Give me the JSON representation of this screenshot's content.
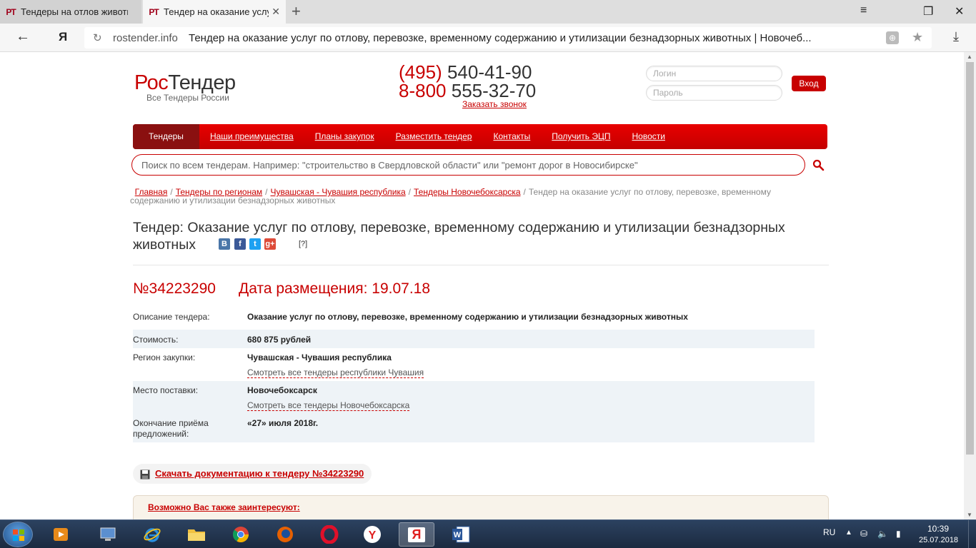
{
  "browser": {
    "tabs": [
      {
        "favicon": "PT",
        "title": "Тендеры на отлов животных"
      },
      {
        "favicon": "PT",
        "title": "Тендер на оказание услуг по отлову"
      }
    ],
    "new_tab": "+",
    "url_host": "rostender.info",
    "url_title": "Тендер на оказание услуг по отлову, перевозке, временному содержанию и утилизации безнадзорных животных | Новочеб...",
    "ya_logo": "Я",
    "win_controls": {
      "menu": "≡",
      "restore": "❐",
      "close": "✕"
    }
  },
  "header": {
    "logo_part1": "Рос",
    "logo_part2": "Тендер",
    "logo_sub": "Все Тендеры России",
    "phone1_code": "(495)",
    "phone1_num": "540-41-90",
    "phone2_code": "8-800",
    "phone2_num": "555-32-70",
    "callback": "Заказать звонок",
    "login_placeholder": "Логин",
    "password_placeholder": "Пароль",
    "login_button": "Вход"
  },
  "menu": [
    "Тендеры",
    "Наши преимущества",
    "Планы закупок",
    "Разместить тендер",
    "Контакты",
    "Получить ЭЦП",
    "Новости"
  ],
  "search": {
    "placeholder": "Поиск по всем тендерам. Например: \"строительство в Свердловской области\" или \"ремонт дорог в Новосибирске\""
  },
  "breadcrumbs": {
    "items": [
      "Главная",
      "Тендеры по регионам",
      "Чувашская - Чувашия республика",
      "Тендеры Новочебоксарска"
    ],
    "current": "Тендер на оказание услуг по отлову, перевозке, временному содержанию и утилизации безнадзорных животных",
    "separator": "/"
  },
  "tender": {
    "title": "Тендер: Оказание услуг по отлову, перевозке, временному содержанию и утилизации безнадзорных животных",
    "help": "[?]",
    "number": "№34223290",
    "date_label": "Дата размещения: 19.07.18",
    "rows": [
      {
        "label": "Описание тендера:",
        "value": "Оказание услуг по отлову, перевозке, временному содержанию и утилизации безнадзорных животных"
      },
      {
        "label": "Стоимость:",
        "value": "680 875 рублей"
      },
      {
        "label": "Регион закупки:",
        "value": "Чувашская - Чувашия республика",
        "link": "Смотреть все тендеры республики Чувашия"
      },
      {
        "label": "Место поставки:",
        "value": "Новочебоксарск",
        "link": "Смотреть все тендеры Новочебоксарска"
      },
      {
        "label": "Окончание приёма предложений:",
        "value": "«27» июля 2018г."
      }
    ],
    "download": "Скачать документацию к тендеру №34223290",
    "also": "Возможно Вас также заинтересуют:"
  },
  "social": {
    "vk": "В",
    "fb": "f",
    "tw": "t",
    "gp": "g+"
  },
  "taskbar": {
    "lang": "RU",
    "time": "10:39",
    "date": "25.07.2018",
    "ya_label": "Я"
  },
  "colors": {
    "brand": "#c80000",
    "menu_active": "#8a1010",
    "row_shade": "#eef3f7"
  }
}
